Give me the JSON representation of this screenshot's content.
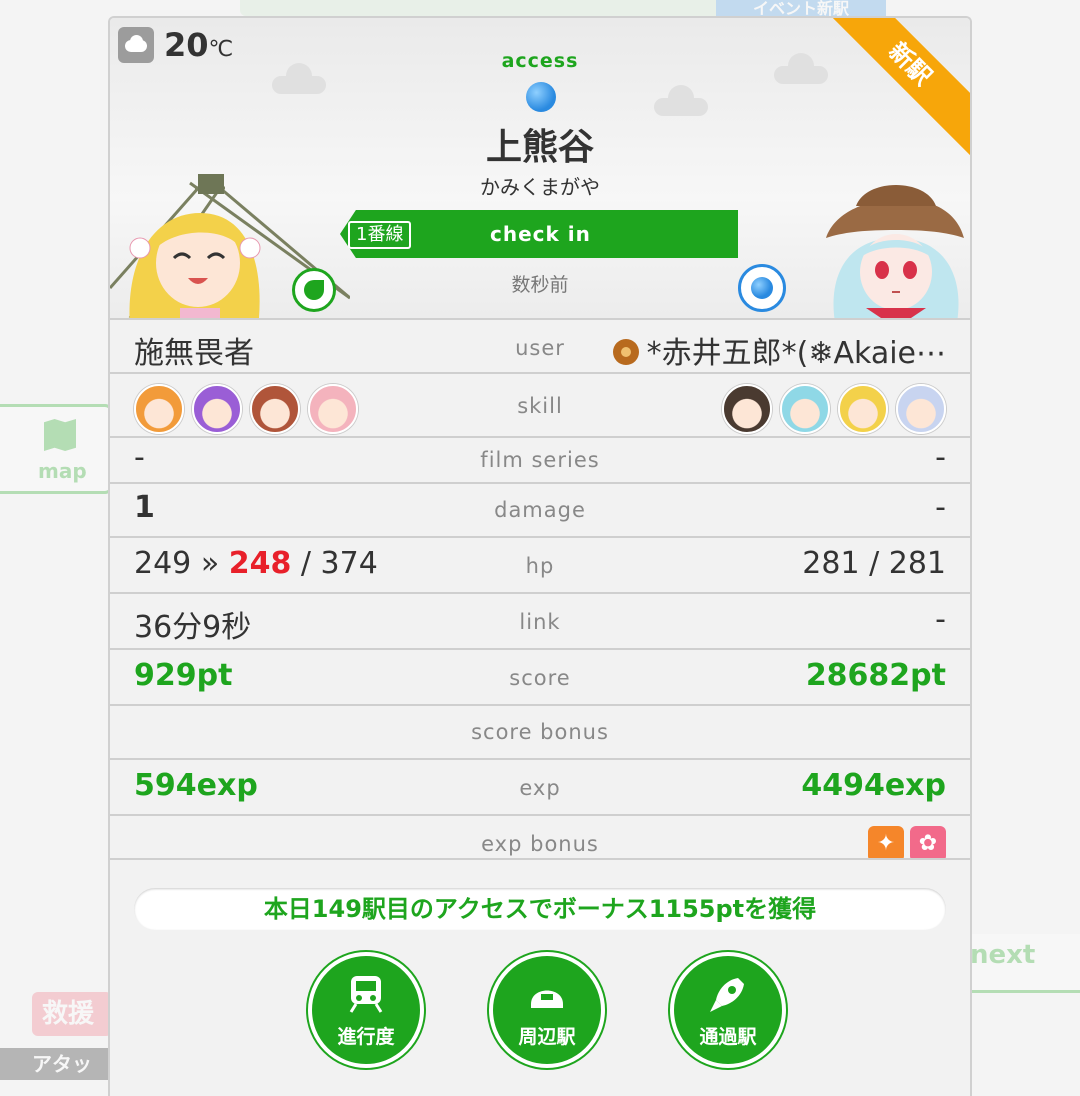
{
  "background": {
    "top_event": "イベント新駅",
    "map_label": "map",
    "next_label": "next",
    "rescue_label": "救援",
    "attack_label": "アタッ"
  },
  "header": {
    "temperature": "20",
    "temperature_unit": "℃",
    "weather_icon": "cloud-icon",
    "new_station_ribbon": "新駅",
    "access_label": "access",
    "station_name": "上熊谷",
    "station_reading": "かみくまがや",
    "line_badge": "1番線",
    "checkin_label": "check in",
    "time_ago": "数秒前"
  },
  "rows": {
    "user": {
      "label": "user",
      "left": "施無畏者",
      "right": "*赤井五郎*(❄Akaie⋯"
    },
    "skill": {
      "label": "skill"
    },
    "film_series": {
      "label": "film series",
      "left": "-",
      "right": "-"
    },
    "damage": {
      "label": "damage",
      "left": "1",
      "right": "-"
    },
    "hp": {
      "label": "hp",
      "left_before": "249",
      "arrow": "»",
      "left_after": "248",
      "left_max": "/ 374",
      "right": "281 / 281"
    },
    "link": {
      "label": "link",
      "left": "36分9秒",
      "right": "-"
    },
    "score": {
      "label": "score",
      "left": "929pt",
      "right": "28682pt"
    },
    "score_bonus": {
      "label": "score bonus"
    },
    "exp": {
      "label": "exp",
      "left": "594exp",
      "right": "4494exp"
    },
    "exp_bonus": {
      "label": "exp bonus"
    }
  },
  "footer": {
    "bonus_message": "本日149駅目のアクセスでボーナス1155ptを獲得",
    "buttons": [
      {
        "label": "進行度",
        "icon": "train-icon"
      },
      {
        "label": "周辺駅",
        "icon": "station-dome-icon"
      },
      {
        "label": "通過駅",
        "icon": "rocket-icon"
      }
    ]
  },
  "colors": {
    "accent_green": "#1ea51e",
    "damage_red": "#e8202a",
    "ribbon_orange": "#f7a60a",
    "attr_blue": "#2a8ae0"
  }
}
